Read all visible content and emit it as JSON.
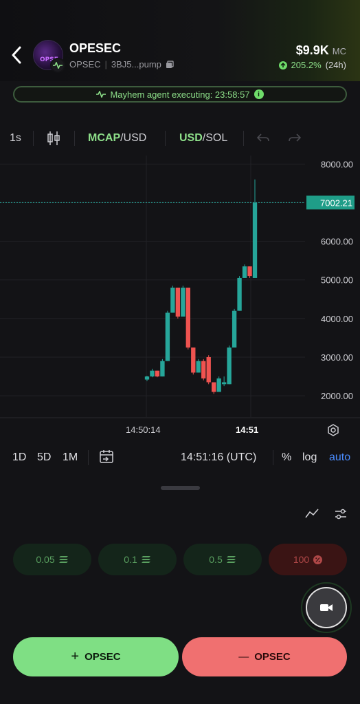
{
  "header": {
    "back_icon": "chevron-left-icon",
    "token_name": "OPESEC",
    "avatar_text": "OPSE",
    "ticker": "OPSEC",
    "address": "3BJ5...pump",
    "market_cap": "$9.9K",
    "market_cap_unit": "MC",
    "change_pct": "205.2%",
    "change_period": "(24h)",
    "accent_up": "#8ee08a"
  },
  "agent_banner": {
    "text": "Mayhem agent executing: 23:58:57",
    "info_glyph": "i"
  },
  "chart_toolbar": {
    "interval": "1s",
    "mcap_label": "MCAP",
    "mcap_suffix": "/USD",
    "usd_label": "USD",
    "usd_suffix": "/SOL"
  },
  "chart_data": {
    "type": "candlestick",
    "y_ticks": [
      "8000.00",
      "7000.00",
      "6000.00",
      "5000.00",
      "4000.00",
      "3000.00",
      "2000.00"
    ],
    "ylim": [
      1450,
      8220
    ],
    "current_price": 7002.21,
    "current_price_label": "7002.21",
    "x_ticks": [
      "14:50:14",
      "14:51"
    ],
    "up_color": "#26a69a",
    "down_color": "#ef5350",
    "candles": [
      {
        "o": 2420,
        "h": 2520,
        "l": 2380,
        "c": 2500
      },
      {
        "o": 2500,
        "h": 2700,
        "l": 2480,
        "c": 2650
      },
      {
        "o": 2650,
        "h": 2650,
        "l": 2480,
        "c": 2500
      },
      {
        "o": 2500,
        "h": 2950,
        "l": 2500,
        "c": 2900
      },
      {
        "o": 2900,
        "h": 4200,
        "l": 2900,
        "c": 4150
      },
      {
        "o": 4150,
        "h": 4850,
        "l": 4150,
        "c": 4800
      },
      {
        "o": 4800,
        "h": 4800,
        "l": 4000,
        "c": 4050
      },
      {
        "o": 4050,
        "h": 4850,
        "l": 4050,
        "c": 4800
      },
      {
        "o": 4800,
        "h": 4800,
        "l": 3200,
        "c": 3250
      },
      {
        "o": 3250,
        "h": 3250,
        "l": 2550,
        "c": 2600
      },
      {
        "o": 2600,
        "h": 2950,
        "l": 2600,
        "c": 2900
      },
      {
        "o": 2900,
        "h": 2950,
        "l": 2400,
        "c": 2450
      },
      {
        "o": 3000,
        "h": 3050,
        "l": 2300,
        "c": 2350
      },
      {
        "o": 2350,
        "h": 2350,
        "l": 2050,
        "c": 2100
      },
      {
        "o": 2100,
        "h": 2500,
        "l": 2100,
        "c": 2450
      },
      {
        "o": 2300,
        "h": 2500,
        "l": 2250,
        "c": 2350
      },
      {
        "o": 2300,
        "h": 3300,
        "l": 2300,
        "c": 3250
      },
      {
        "o": 3250,
        "h": 4250,
        "l": 3250,
        "c": 4200
      },
      {
        "o": 4200,
        "h": 5100,
        "l": 4200,
        "c": 5050
      },
      {
        "o": 5050,
        "h": 5400,
        "l": 5050,
        "c": 5350
      },
      {
        "o": 5350,
        "h": 5350,
        "l": 5050,
        "c": 5100
      },
      {
        "o": 5050,
        "h": 7600,
        "l": 5050,
        "c": 7000
      }
    ]
  },
  "bottom_toolbar": {
    "ranges": [
      "1D",
      "5D",
      "1M"
    ],
    "time": "14:51:16 (UTC)",
    "pct": "%",
    "log": "log",
    "auto": "auto"
  },
  "quick_buys": [
    {
      "label": "0.05",
      "icon": "solana-icon"
    },
    {
      "label": "0.1",
      "icon": "solana-icon"
    },
    {
      "label": "0.5",
      "icon": "solana-icon"
    },
    {
      "label": "100",
      "icon": "percent-icon"
    }
  ],
  "actions": {
    "buy_prefix": "+",
    "buy_label": "OPSEC",
    "sell_prefix": "—",
    "sell_label": "OPSEC"
  }
}
